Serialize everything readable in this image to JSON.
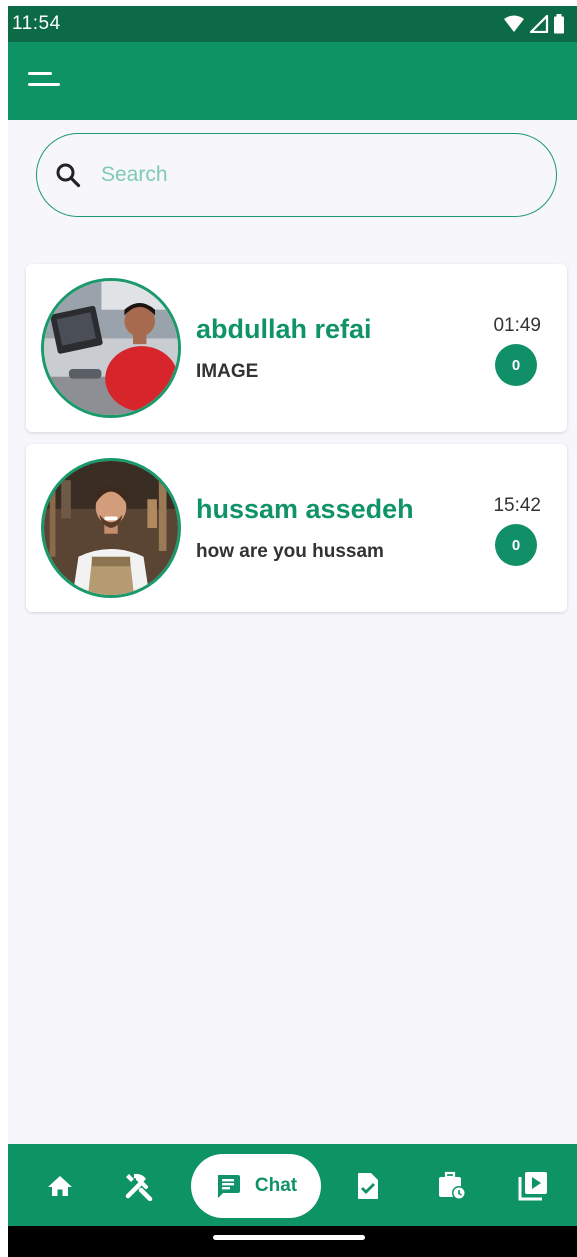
{
  "status_bar": {
    "time": "11:54",
    "icons": [
      "wifi-icon",
      "signal-icon",
      "battery-icon"
    ]
  },
  "app_bar": {
    "menu_icon": "menu-icon"
  },
  "search": {
    "placeholder": "Search",
    "value": "",
    "icon": "search-icon"
  },
  "chats": [
    {
      "name": "abdullah refai",
      "preview": "IMAGE",
      "time": "01:49",
      "unread": "0"
    },
    {
      "name": "hussam assedeh",
      "preview": "how are you hussam",
      "time": "15:42",
      "unread": "0"
    }
  ],
  "bottom_nav": {
    "items": [
      "home-icon",
      "tools-icon",
      "chat-icon",
      "document-check-icon",
      "briefcase-clock-icon",
      "video-library-icon"
    ],
    "active_label": "Chat"
  },
  "colors": {
    "primary": "#0e9365",
    "status_bar": "#0c6b46",
    "accent_text": "#11936a",
    "background": "#f6f6fb"
  }
}
